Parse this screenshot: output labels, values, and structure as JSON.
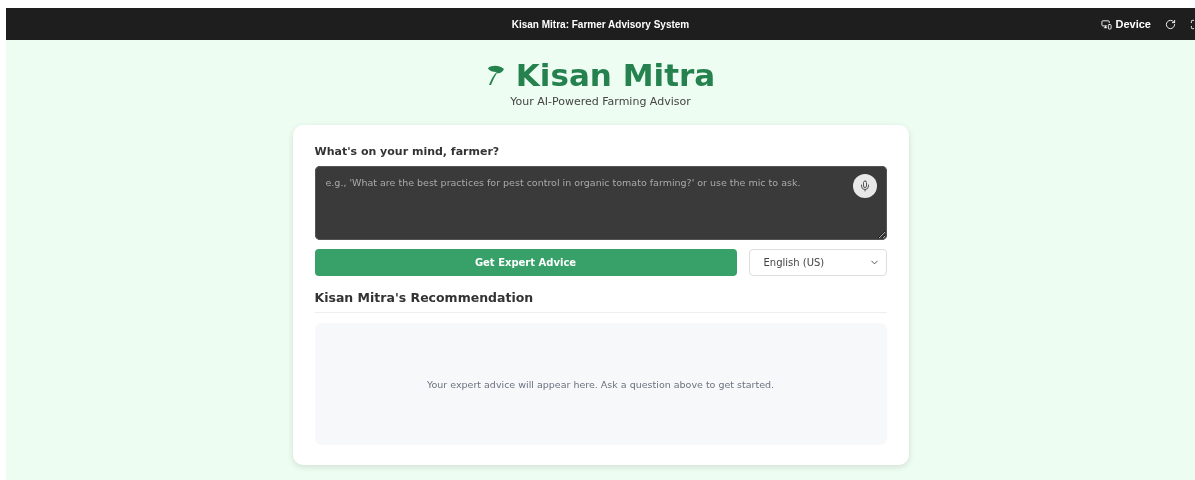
{
  "window": {
    "title": "Kisan Mitra: Farmer Advisory System",
    "device_button": "Device"
  },
  "header": {
    "title": "Kisan Mitra",
    "subtitle": "Your AI-Powered Farming Advisor"
  },
  "question": {
    "label": "What's on your mind, farmer?",
    "placeholder": "e.g., 'What are the best practices for pest control in organic tomato farming?' or use the mic to ask."
  },
  "submit_button": "Get Expert Advice",
  "language": {
    "value": "English (US)"
  },
  "recommendation": {
    "heading": "Kisan Mitra's Recommendation",
    "empty_text": "Your expert advice will appear here. Ask a question above to get started."
  }
}
